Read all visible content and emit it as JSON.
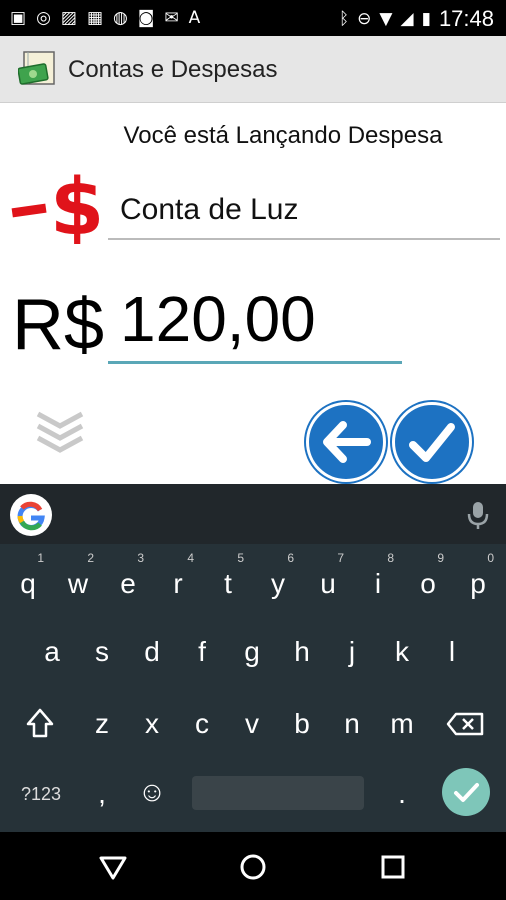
{
  "status_bar": {
    "left_icons": [
      "message-icon",
      "whatsapp-icon",
      "image-icon",
      "qr-icon",
      "shield-icon",
      "instagram-icon",
      "mail-icon",
      "font-icon"
    ],
    "right_icons": [
      "bluetooth-icon",
      "dnd-icon",
      "wifi-icon",
      "signal-icon",
      "battery-icon"
    ],
    "time": "17:48"
  },
  "app_bar": {
    "title": "Contas e Despesas"
  },
  "form": {
    "subtitle": "Você está Lançando Despesa",
    "description_value": "Conta de Luz",
    "currency_label": "R$",
    "amount_value": "120,00"
  },
  "keyboard": {
    "row1": [
      {
        "k": "q",
        "h": "1"
      },
      {
        "k": "w",
        "h": "2"
      },
      {
        "k": "e",
        "h": "3"
      },
      {
        "k": "r",
        "h": "4"
      },
      {
        "k": "t",
        "h": "5"
      },
      {
        "k": "y",
        "h": "6"
      },
      {
        "k": "u",
        "h": "7"
      },
      {
        "k": "i",
        "h": "8"
      },
      {
        "k": "o",
        "h": "9"
      },
      {
        "k": "p",
        "h": "0"
      }
    ],
    "row2": [
      "a",
      "s",
      "d",
      "f",
      "g",
      "h",
      "j",
      "k",
      "l"
    ],
    "row3": [
      "z",
      "x",
      "c",
      "v",
      "b",
      "n",
      "m"
    ],
    "symbols_label": "?123",
    "comma_label": ",",
    "period_label": ".",
    "emoji_label": "☺"
  },
  "colors": {
    "accent_blue": "#1d72c2",
    "expense_red": "#e0131a",
    "keyboard_bg": "#263238",
    "enter_teal": "#7ec6b9"
  }
}
